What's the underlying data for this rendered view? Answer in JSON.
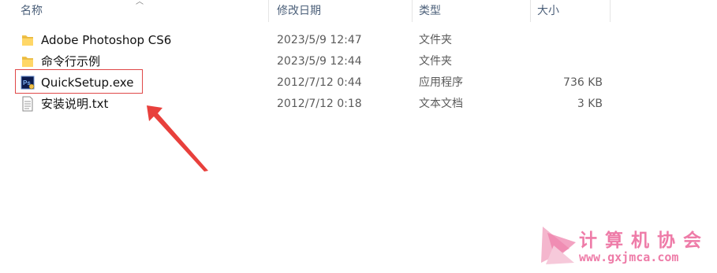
{
  "header": {
    "name": "名称",
    "date_modified": "修改日期",
    "type": "类型",
    "size": "大小"
  },
  "files": [
    {
      "name": "Adobe Photoshop CS6",
      "date": "2023/5/9 12:47",
      "type": "文件夹",
      "size": "",
      "icon": "folder-icon"
    },
    {
      "name": "命令行示例",
      "date": "2023/5/9 12:44",
      "type": "文件夹",
      "size": "",
      "icon": "folder-icon"
    },
    {
      "name": "QuickSetup.exe",
      "date": "2012/7/12 0:44",
      "type": "应用程序",
      "size": "736 KB",
      "icon": "photoshop-app-icon"
    },
    {
      "name": "安装说明.txt",
      "date": "2012/7/12 0:18",
      "type": "文本文档",
      "size": "3 KB",
      "icon": "text-document-icon"
    }
  ],
  "annotation": {
    "highlight_color": "#e04848",
    "arrow_color": "#e8403c",
    "highlighted_file": "QuickSetup.exe"
  },
  "watermark": {
    "title": "计算机协会",
    "url": "www.gxjmca.com",
    "color": "#ee7ca8"
  }
}
